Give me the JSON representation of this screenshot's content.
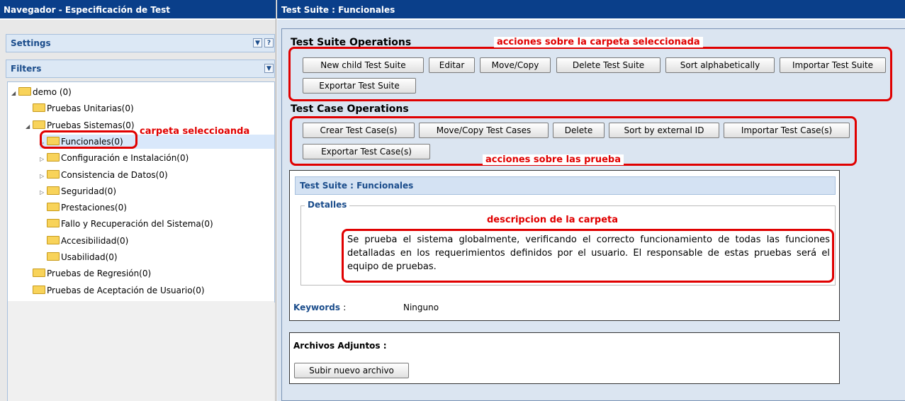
{
  "left": {
    "title": "Navegador - Especificación de Test",
    "settings_label": "Settings",
    "filters_label": "Filters",
    "tree": [
      {
        "label": "demo (0)",
        "depth": 0,
        "arrow": "expanded"
      },
      {
        "label": "Pruebas Unitarias(0)",
        "depth": 1,
        "arrow": "none"
      },
      {
        "label": "Pruebas Sistemas(0)",
        "depth": 1,
        "arrow": "expanded"
      },
      {
        "label": "Funcionales(0)",
        "depth": 2,
        "arrow": "collapsed",
        "selected": true
      },
      {
        "label": "Configuración e Instalación(0)",
        "depth": 2,
        "arrow": "collapsed"
      },
      {
        "label": "Consistencia de Datos(0)",
        "depth": 2,
        "arrow": "collapsed"
      },
      {
        "label": "Seguridad(0)",
        "depth": 2,
        "arrow": "collapsed"
      },
      {
        "label": "Prestaciones(0)",
        "depth": 2,
        "arrow": "none"
      },
      {
        "label": "Fallo y Recuperación del Sistema(0)",
        "depth": 2,
        "arrow": "none"
      },
      {
        "label": "Accesibilidad(0)",
        "depth": 2,
        "arrow": "none"
      },
      {
        "label": "Usabilidad(0)",
        "depth": 2,
        "arrow": "none"
      },
      {
        "label": "Pruebas de Regresión(0)",
        "depth": 1,
        "arrow": "none"
      },
      {
        "label": "Pruebas de Aceptación de Usuario(0)",
        "depth": 1,
        "arrow": "none"
      }
    ],
    "annotation_selected": "carpeta seleccioanda"
  },
  "right": {
    "title": "Test Suite : Funcionales",
    "suite_ops_title": "Test Suite Operations",
    "suite_ops_annotation": "acciones sobre la carpeta seleccionada",
    "suite_buttons": [
      "New child Test Suite",
      "Editar",
      "Move/Copy",
      "Delete Test Suite",
      "Sort alphabetically",
      "Importar Test Suite",
      "Exportar Test Suite"
    ],
    "case_ops_title": "Test Case Operations",
    "case_ops_annotation": "acciones sobre las prueba",
    "case_buttons": [
      "Crear Test Case(s)",
      "Move/Copy Test Cases",
      "Delete",
      "Sort by external ID",
      "Importar Test Case(s)",
      "Exportar Test Case(s)"
    ],
    "details_panel_title": "Test Suite : Funcionales",
    "details_legend": "Detalles",
    "description_annotation": "descripcion de la carpeta",
    "description": "Se prueba el sistema globalmente, verificando el correcto funcionamiento de todas las funciones detalladas en los requerimientos definidos por el usuario. El responsable de estas pruebas será el equipo de pruebas.",
    "keywords_label": "Keywords",
    "keywords_sep": ":",
    "keywords_value": "Ninguno",
    "attachments_title": "Archivos Adjuntos :",
    "upload_button": "Subir nuevo archivo"
  }
}
